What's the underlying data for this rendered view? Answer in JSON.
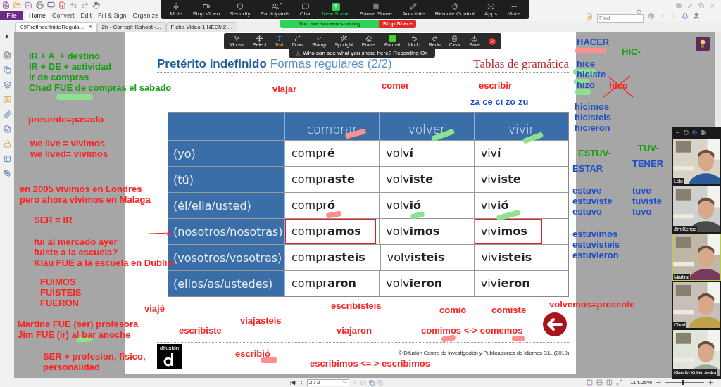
{
  "quick_access": {
    "title": "File"
  },
  "ribbon": [
    {
      "label": "Home",
      "selected": true
    },
    {
      "label": "Convert",
      "selected": false
    },
    {
      "label": "Edit",
      "selected": false
    },
    {
      "label": "Fill & Sign",
      "selected": false
    },
    {
      "label": "Organize",
      "selected": false
    }
  ],
  "find": {
    "placeholder": "Find"
  },
  "doc_tabs": [
    {
      "label": "09PretIndefinidoRegula...",
      "close": "×",
      "selected": true
    },
    {
      "label": "2b - Corregir Kahoot -...",
      "selected": false
    },
    {
      "label": "Ficha Video 1 NEEM2 ...",
      "selected": false
    }
  ],
  "meeting_toolbar": [
    {
      "label": "Mute",
      "highlighted": false
    },
    {
      "label": "Stop Video",
      "highlighted": false
    },
    {
      "label": "Security",
      "highlighted": false
    },
    {
      "label": "Participants",
      "badge": "5",
      "highlighted": false
    },
    {
      "label": "Chat",
      "highlighted": false
    },
    {
      "label": "New Share",
      "highlighted": true
    },
    {
      "label": "Pause Share",
      "highlighted": false
    },
    {
      "label": "Annotate",
      "highlighted": false
    },
    {
      "label": "Remote Control",
      "highlighted": false
    },
    {
      "label": "Apps",
      "highlighted": false
    },
    {
      "label": "More",
      "highlighted": false
    }
  ],
  "sharing_banner": {
    "status": "You are screen sharing",
    "stop": "Stop Share"
  },
  "annotation_toolbar": {
    "tools": [
      {
        "label": "Mouse",
        "selected": false
      },
      {
        "label": "Select",
        "selected": false
      },
      {
        "label": "Text",
        "selected": true
      },
      {
        "label": "Draw",
        "selected": false
      },
      {
        "label": "Stamp",
        "selected": false
      },
      {
        "label": "Spotlight",
        "selected": false
      },
      {
        "label": "Eraser",
        "selected": false
      },
      {
        "label": "Format",
        "selected": false
      },
      {
        "label": "Undo",
        "selected": false
      },
      {
        "label": "Redo",
        "selected": false
      },
      {
        "label": "Clear",
        "selected": false
      },
      {
        "label": "Save",
        "selected": false
      }
    ],
    "notice": "Who can see what you share here? Recording On"
  },
  "slide": {
    "title": "Pretérito indefinido",
    "subtitle": "Formas regulares (2/2)",
    "section": "Tablas de gramática",
    "table": {
      "columns": [
        "comprar",
        "volver",
        "vivir"
      ],
      "rows": [
        {
          "person": "(yo)",
          "cells": [
            {
              "text": "compr**é**",
              "boxed": false
            },
            {
              "text": "volv**í**",
              "boxed": false
            },
            {
              "text": "viv**í**",
              "boxed": false
            }
          ]
        },
        {
          "person": "(tú)",
          "cells": [
            {
              "text": "compr**aste**",
              "boxed": false
            },
            {
              "text": "volv**iste**",
              "boxed": false
            },
            {
              "text": "viv**iste**",
              "boxed": false
            }
          ]
        },
        {
          "person": "(él/ella/usted)",
          "cells": [
            {
              "text": "compr**ó**",
              "boxed": false
            },
            {
              "text": "volv**ió**",
              "boxed": false
            },
            {
              "text": "viv**ió**",
              "boxed": false
            }
          ]
        },
        {
          "person": "(nosotros/nosotras)",
          "cells": [
            {
              "text": "compr**amos**",
              "boxed": true
            },
            {
              "text": "volv**imos**",
              "boxed": false
            },
            {
              "text": "viv**imos**",
              "boxed": true
            }
          ]
        },
        {
          "person": "(vosotros/vosotras)",
          "cells": [
            {
              "text": "compr**asteis**",
              "boxed": false
            },
            {
              "text": "volv**isteis**",
              "boxed": false
            },
            {
              "text": "viv**isteis**",
              "boxed": false
            }
          ]
        },
        {
          "person": "(ellos/as/ustedes)",
          "cells": [
            {
              "text": "compr**aron**",
              "boxed": false
            },
            {
              "text": "volv**ieron**",
              "boxed": false
            },
            {
              "text": "viv**ieron**",
              "boxed": false
            }
          ]
        }
      ]
    },
    "logo": "difusión",
    "copyright": "© Difusión Centro de Investigación y Publicaciones de Idiomas S.L. (2019)"
  },
  "annotations": [
    {
      "lines": [
        "IR + A  + destino",
        "IR + DE + actividad",
        "ir de compras",
        "Chad FUE de compras el sabado"
      ],
      "color": "#17a012",
      "struck": false
    },
    {
      "lines": [
        "presente=pasado"
      ],
      "color": "#ff2020",
      "struck": false
    },
    {
      "lines": [
        "we live = vivimos",
        "we lived= vivimos"
      ],
      "color": "#ff2020",
      "struck": false
    },
    {
      "lines": [
        "en 2005 vivimos en Londres",
        "pero ahora vivimos en Malaga"
      ],
      "color": "#ff2020",
      "struck": false
    },
    {
      "lines": [
        "SER = IR"
      ],
      "color": "#ff2020",
      "struck": false
    },
    {
      "lines": [
        "fui al mercado ayer",
        "fuiste a la escuela?",
        "Klau FUE a la escuela en Dublin"
      ],
      "color": "#ff2020",
      "struck": false
    },
    {
      "lines": [
        "FUIMOS",
        "FUISTEIS",
        "FUERON"
      ],
      "color": "#ff2020",
      "struck": false
    },
    {
      "lines": [
        "viajé"
      ],
      "color": "#ff2020",
      "struck": false
    },
    {
      "lines": [
        "Martine FUE (ser) profesora",
        "Jim FUE (ir) al bar anoche"
      ],
      "color": "#ff2020",
      "struck": false
    },
    {
      "lines": [
        "SER + profesion, fisico,",
        "personalidad"
      ],
      "color": "#ff2020",
      "struck": false
    },
    {
      "lines": [
        "viajar"
      ],
      "color": "#ff2020",
      "struck": false
    },
    {
      "lines": [
        "comer"
      ],
      "color": "#ff2020",
      "struck": false
    },
    {
      "lines": [
        "escribir"
      ],
      "color": "#ff2020",
      "struck": false
    },
    {
      "lines": [
        "za ce ci zo zu"
      ],
      "color": "#1f4fc7",
      "struck": false
    },
    {
      "lines": [
        "escribiste"
      ],
      "color": "#ff2020",
      "struck": false
    },
    {
      "lines": [
        "viajasteis"
      ],
      "color": "#ff2020",
      "struck": false
    },
    {
      "lines": [
        "escribisteis"
      ],
      "color": "#ff2020",
      "struck": false
    },
    {
      "lines": [
        "viajaron"
      ],
      "color": "#ff2020",
      "struck": false
    },
    {
      "lines": [
        "comió"
      ],
      "color": "#ff2020",
      "struck": false
    },
    {
      "lines": [
        "comiste"
      ],
      "color": "#ff2020",
      "struck": false
    },
    {
      "lines": [
        "comimos <-> comemos"
      ],
      "color": "#ff2020",
      "struck": false
    },
    {
      "lines": [
        "volvemos=presente"
      ],
      "color": "#ff2020",
      "struck": false
    },
    {
      "lines": [
        "escribió"
      ],
      "color": "#ff2020",
      "struck": false
    },
    {
      "lines": [
        "escribimos <= > escribimos"
      ],
      "color": "#ff2020",
      "struck": false
    },
    {
      "lines": [
        "HACER"
      ],
      "color": "#1f4fc7",
      "struck": false
    },
    {
      "lines": [
        "HIC-"
      ],
      "color": "#17a012",
      "struck": false
    },
    {
      "lines": [
        "hice",
        "hiciste",
        "hizo"
      ],
      "color": "#1f4fc7",
      "struck": false
    },
    {
      "lines": [
        "hico"
      ],
      "color": "#ff2020",
      "struck": true
    },
    {
      "lines": [
        "hicimos",
        "hicisteis",
        "hicieron"
      ],
      "color": "#1f4fc7",
      "struck": false
    },
    {
      "lines": [
        "ESTUV-"
      ],
      "color": "#17a012",
      "struck": false
    },
    {
      "lines": [
        "ESTAR"
      ],
      "color": "#1f4fc7",
      "struck": false
    },
    {
      "lines": [
        "estuve",
        "estuviste",
        "estuvo"
      ],
      "color": "#1f4fc7",
      "struck": false
    },
    {
      "lines": [
        "estuvimos",
        "estuvisteis",
        "estuvieron"
      ],
      "color": "#1f4fc7",
      "struck": false
    },
    {
      "lines": [
        "TUV-"
      ],
      "color": "#17a012",
      "struck": false
    },
    {
      "lines": [
        "TENER"
      ],
      "color": "#1f4fc7",
      "struck": false
    },
    {
      "lines": [
        "tuve",
        "tuviste",
        "tuvo"
      ],
      "color": "#1f4fc7",
      "struck": false
    }
  ],
  "highlights": [
    {
      "color": "#ff8f8f"
    },
    {
      "color": "#8fe08f"
    },
    {
      "color": "#8fe08f"
    },
    {
      "color": "#ff8f8f"
    },
    {
      "color": "#8fe08f"
    },
    {
      "color": "#8fe08f"
    },
    {
      "color": "#8fe08f"
    },
    {
      "color": "#8fe08f"
    },
    {
      "color": "#ff8f8f"
    },
    {
      "color": "#8fe08f"
    },
    {
      "color": "#8fe08f"
    },
    {
      "color": "#8fe08f"
    },
    {
      "color": "#ff8f8f"
    },
    {
      "color": "#ff8f8f"
    },
    {
      "color": "#ff8f8f"
    }
  ],
  "participants": [
    {
      "name": "Lolo",
      "active": false
    },
    {
      "name": "Jim Kehoe",
      "active": false
    },
    {
      "name": "Martine",
      "active": true
    },
    {
      "name": "Chad",
      "active": false
    },
    {
      "name": "Klaudia Kulakowska",
      "active": false
    }
  ],
  "status_bar": {
    "page": "2 / 2",
    "zoom": "114.25%",
    "zoom_slider": {
      "level": 0.45
    }
  }
}
